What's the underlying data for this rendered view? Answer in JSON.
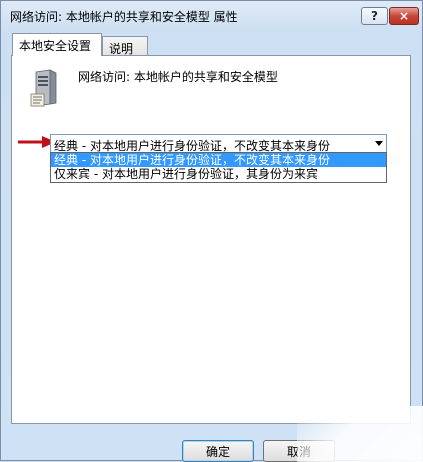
{
  "window": {
    "title": "网络访问: 本地帐户的共享和安全模型 属性"
  },
  "controls": {
    "help": "?",
    "close": "×"
  },
  "tabs": [
    {
      "label": "本地安全设置",
      "active": true
    },
    {
      "label": "说明",
      "active": false
    }
  ],
  "policy": {
    "name": "网络访问: 本地帐户的共享和安全模型"
  },
  "select": {
    "value": "经典 - 对本地用户进行身份验证，不改变其本来身份",
    "options": [
      {
        "label": "经典 - 对本地用户进行身份验证，不改变其本来身份",
        "highlighted": true
      },
      {
        "label": "仅来宾 - 对本地用户进行身份验证，其身份为来宾",
        "highlighted": false
      }
    ]
  },
  "buttons": {
    "ok": "确定",
    "cancel": "取消"
  },
  "colors": {
    "highlight": "#3399ff",
    "arrow": "#c0101a",
    "close": "#c7473a"
  }
}
